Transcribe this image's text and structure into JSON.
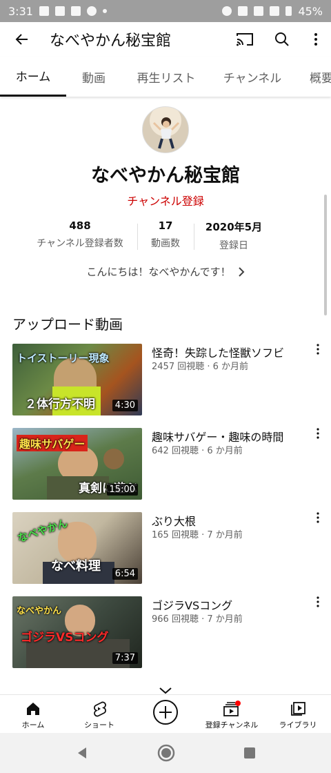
{
  "status_bar": {
    "time": "3:31",
    "battery": "45%"
  },
  "app_bar": {
    "title": "なべやかん秘宝館"
  },
  "tabs": [
    {
      "label": "ホーム",
      "active": true
    },
    {
      "label": "動画"
    },
    {
      "label": "再生リスト"
    },
    {
      "label": "チャンネル"
    },
    {
      "label": "概要"
    }
  ],
  "channel": {
    "name": "なべやかん秘宝館",
    "subscribe_label": "チャンネル登録",
    "stats": [
      {
        "value": "488",
        "label": "チャンネル登録者数"
      },
      {
        "value": "17",
        "label": "動画数"
      },
      {
        "value": "2020年5月",
        "label": "登録日"
      }
    ],
    "about_text": "こんにちは！なべやかんです！"
  },
  "section_title": "アップロード動画",
  "videos": [
    {
      "title": "怪奇！失踪した怪獣ソフビ",
      "meta": "2457 回視聴 · 6 か月前",
      "duration": "4:30",
      "thumb_top": "トイストーリー現象",
      "thumb_bottom": "２体行方不明"
    },
    {
      "title": "趣味サバゲー・趣味の時間",
      "meta": "642 回視聴 · 6 か月前",
      "duration": "15:00",
      "thumb_top": "趣味サバゲー",
      "thumb_bottom": "真剣に遊ぶ"
    },
    {
      "title": "ぶり大根",
      "meta": "165 回視聴 · 7 か月前",
      "duration": "6:54",
      "thumb_top": "なべやかん",
      "thumb_bottom": "なべ料理"
    },
    {
      "title": "ゴジラVSコング",
      "meta": "966 回視聴 · 7 か月前",
      "duration": "7:37",
      "thumb_top": "なべやかん",
      "thumb_bottom": "ゴジラVSコング"
    }
  ],
  "bottom_nav": [
    {
      "label": "ホーム",
      "icon": "home-icon"
    },
    {
      "label": "ショート",
      "icon": "shorts-icon"
    },
    {
      "label": "",
      "icon": "create-icon"
    },
    {
      "label": "登録チャンネル",
      "icon": "subscriptions-icon"
    },
    {
      "label": "ライブラリ",
      "icon": "library-icon"
    }
  ],
  "colors": {
    "accent": "#cc0000",
    "text_secondary": "#606060"
  }
}
